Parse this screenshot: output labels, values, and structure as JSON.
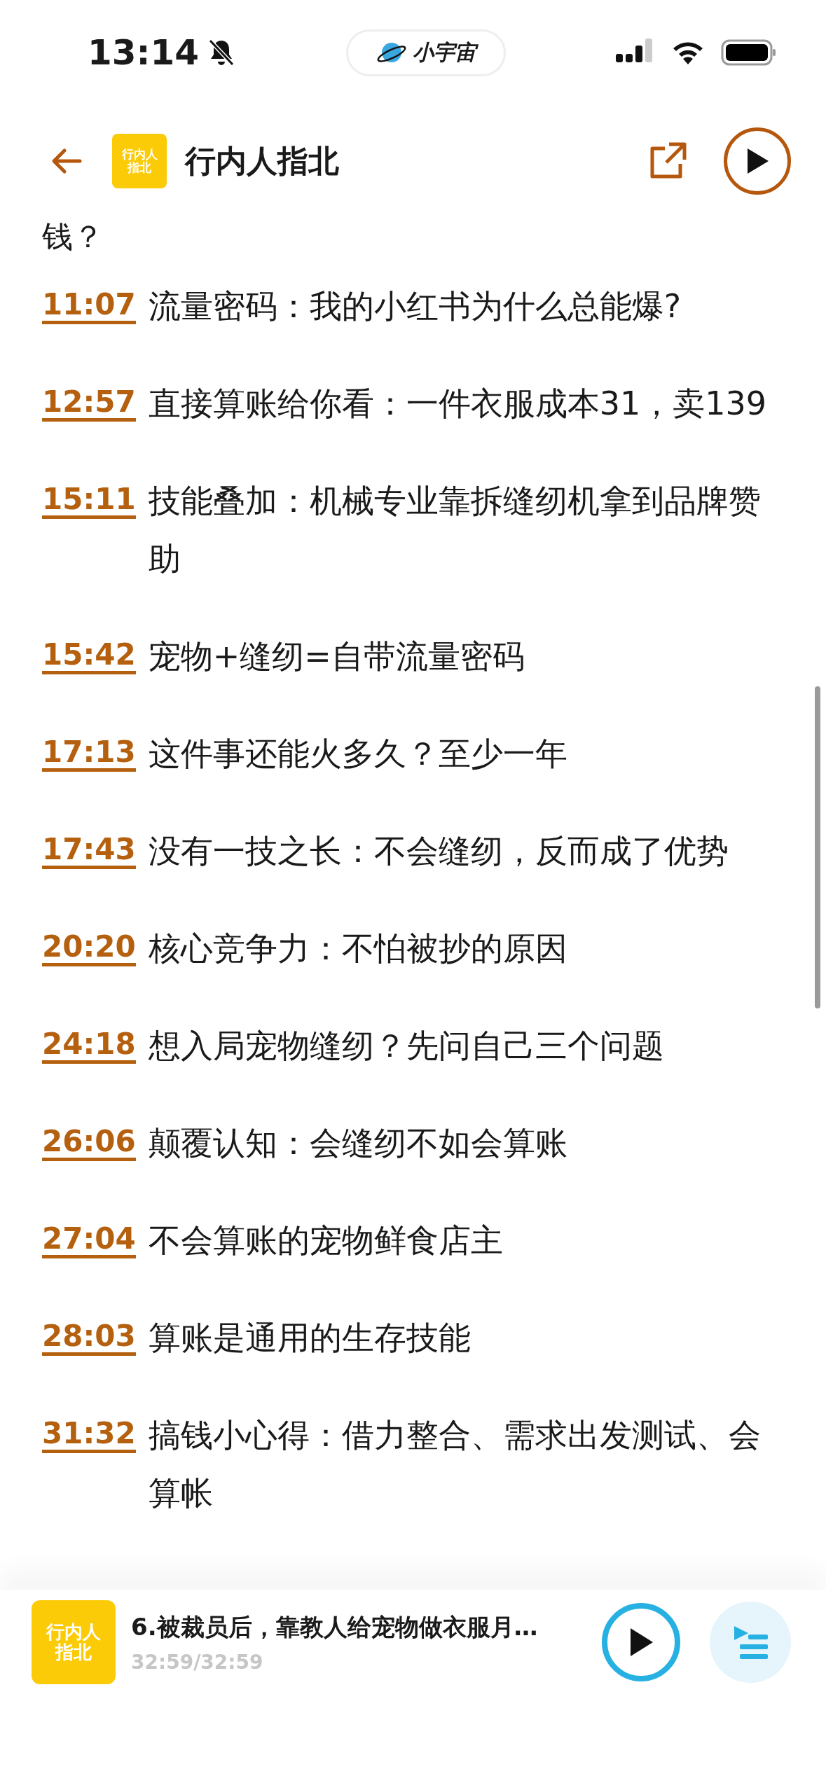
{
  "status_bar": {
    "time": "13:14",
    "pill_label": "小宇宙"
  },
  "header": {
    "title": "行内人指北",
    "logo_lines": [
      "行内人",
      "指北"
    ]
  },
  "cut_line": "钱？",
  "chapters": [
    {
      "time": "11:07",
      "title": "流量密码：我的小红书为什么总能爆?"
    },
    {
      "time": "12:57",
      "title": "直接算账给你看：一件衣服成本31，卖139"
    },
    {
      "time": "15:11",
      "title": "技能叠加：机械专业靠拆缝纫机拿到品牌赞助"
    },
    {
      "time": "15:42",
      "title": "宠物+缝纫=自带流量密码"
    },
    {
      "time": "17:13",
      "title": "这件事还能火多久？至少一年"
    },
    {
      "time": "17:43",
      "title": "没有一技之长：不会缝纫，反而成了优势"
    },
    {
      "time": "20:20",
      "title": "核心竞争力：不怕被抄的原因"
    },
    {
      "time": "24:18",
      "title": "想入局宠物缝纫？先问自己三个问题"
    },
    {
      "time": "26:06",
      "title": "颠覆认知：会缝纫不如会算账"
    },
    {
      "time": "27:04",
      "title": "不会算账的宠物鲜食店主"
    },
    {
      "time": "28:03",
      "title": "算账是通用的生存技能"
    },
    {
      "time": "31:32",
      "title": "搞钱小心得：借力整合、需求出发测试、会算帐"
    }
  ],
  "player": {
    "title": "6.被裁员后，靠教人给宠物做衣服月…",
    "progress": "32:59/32:59",
    "logo_lines": [
      "行内人",
      "指北"
    ]
  }
}
